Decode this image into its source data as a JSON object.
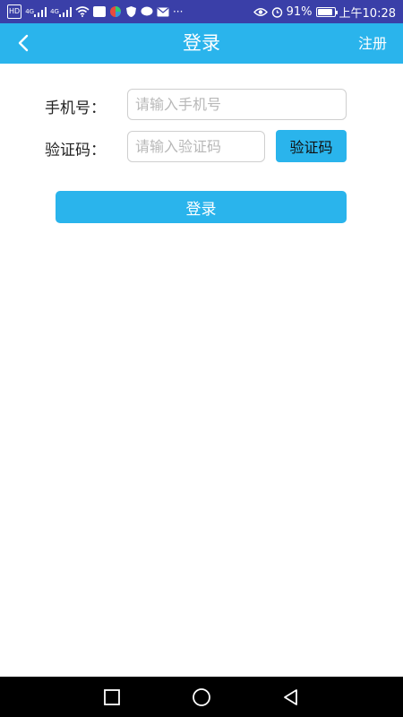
{
  "status_bar": {
    "hd": "HD",
    "net1": "4G",
    "net2": "4G",
    "more": "···",
    "battery_pct": "91%",
    "battery_level": 0.91,
    "time": "上午10:28"
  },
  "nav": {
    "title": "登录",
    "register": "注册"
  },
  "form": {
    "phone_label": "手机号：",
    "phone_placeholder": "请输入手机号",
    "code_label": "验证码：",
    "code_placeholder": "请输入验证码",
    "code_button": "验证码"
  },
  "login_button": "登录",
  "colors": {
    "status_bar": "#3a3fa8",
    "accent": "#2ab4ec"
  }
}
